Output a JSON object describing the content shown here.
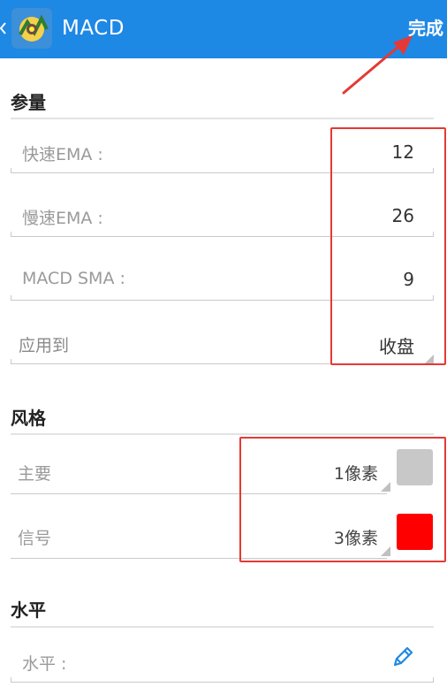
{
  "header": {
    "title": "MACD",
    "done_label": "完成"
  },
  "sections": {
    "params_title": "参量",
    "style_title": "风格",
    "levels_title": "水平"
  },
  "params": {
    "fast_ema": {
      "label": "快速EMA :",
      "value": "12"
    },
    "slow_ema": {
      "label": "慢速EMA :",
      "value": "26"
    },
    "macd_sma": {
      "label": "MACD SMA :",
      "value": "9"
    },
    "apply_to": {
      "label": "应用到",
      "value": "收盘"
    }
  },
  "style": {
    "main": {
      "label": "主要",
      "width": "1像素",
      "color": "#c8c8c8"
    },
    "signal": {
      "label": "信号",
      "width": "3像素",
      "color": "#ff0000"
    }
  },
  "levels": {
    "label": "水平 :"
  },
  "icons": {
    "app": "metatrader-app-icon",
    "back": "back-chevron-icon",
    "edit": "pencil-icon"
  },
  "colors": {
    "header": "#1e88e5",
    "annotation": "#e53935",
    "accent": "#1e88e5"
  }
}
